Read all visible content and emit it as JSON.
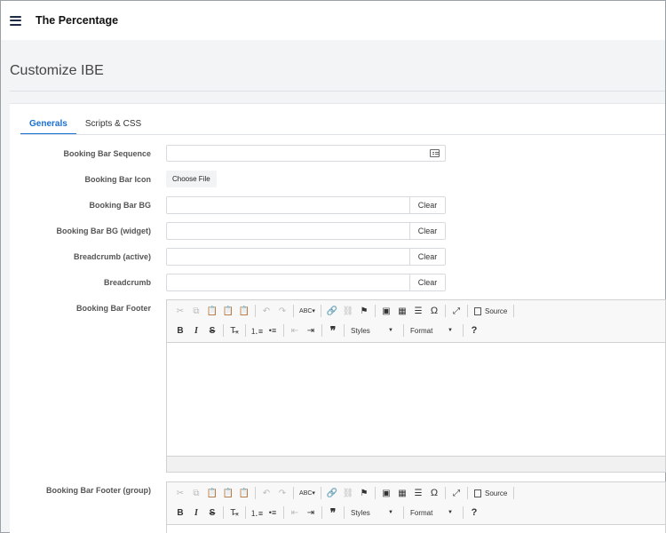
{
  "app": {
    "title": "The Percentage"
  },
  "page": {
    "title": "Customize IBE"
  },
  "tabs": [
    {
      "label": "Generals",
      "active": true
    },
    {
      "label": "Scripts & CSS",
      "active": false
    }
  ],
  "form": {
    "booking_bar_sequence": {
      "label": "Booking Bar Sequence",
      "value": ""
    },
    "booking_bar_icon": {
      "label": "Booking Bar Icon",
      "button": "Choose File"
    },
    "booking_bar_bg": {
      "label": "Booking Bar BG",
      "clear": "Clear"
    },
    "booking_bar_bg_widget": {
      "label": "Booking Bar BG (widget)",
      "clear": "Clear"
    },
    "breadcrumb_active": {
      "label": "Breadcrumb (active)",
      "clear": "Clear"
    },
    "breadcrumb": {
      "label": "Breadcrumb",
      "clear": "Clear"
    },
    "booking_bar_footer": {
      "label": "Booking Bar Footer"
    },
    "booking_bar_footer_group": {
      "label": "Booking Bar Footer (group)"
    }
  },
  "editor_toolbar": {
    "source_label": "Source",
    "styles_label": "Styles",
    "format_label": "Format",
    "help_label": "?"
  },
  "icons": {
    "cut": "scissors-icon",
    "copy": "copy-icon",
    "paste": "paste-icon",
    "undo": "undo-icon",
    "redo": "redo-icon",
    "spellcheck": "spellcheck-icon",
    "link": "link-icon",
    "unlink": "unlink-icon",
    "anchor": "flag-icon",
    "image": "image-icon",
    "table": "table-icon",
    "hr": "horizontal-rule-icon",
    "special_char": "omega-icon",
    "maximize": "maximize-icon"
  },
  "colors": {
    "accent": "#1a6fd3",
    "background": "#f3f4f6"
  }
}
